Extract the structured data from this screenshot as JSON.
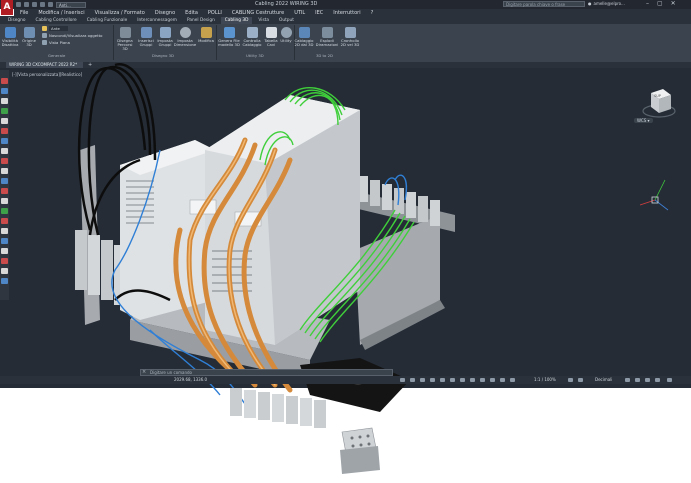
{
  "app": {
    "logo": "A",
    "title": "Cabling 2022  WIRING 3D",
    "workspace": "Anti...",
    "search_placeholder": "Digitare parola chiave o frase",
    "user": "amelle@elpro...",
    "win_controls": [
      "–",
      "▢",
      "✕"
    ]
  },
  "menu": [
    "File",
    "Modifica / Inserisci",
    "Visualizza / Formato",
    "Disegno",
    "Edita",
    "POLLI",
    "CABLING Cestrutture",
    "UTIL",
    "IEC",
    "Interruttori",
    "?"
  ],
  "ribbon_tabs": [
    {
      "label": "Disegno",
      "active": false
    },
    {
      "label": "Cabling Controllore",
      "active": false
    },
    {
      "label": "Cabling Funzionale",
      "active": false
    },
    {
      "label": "Interconnessagem",
      "active": false
    },
    {
      "label": "Panel Design",
      "active": false
    },
    {
      "label": "Cabling 3D",
      "active": true
    },
    {
      "label": "Vista",
      "active": false
    },
    {
      "label": "Output",
      "active": false
    }
  ],
  "ribbon": {
    "visibility_label": "Visibilità Disattiva",
    "origin_label": "Origine 3D",
    "combo_value": "Ante",
    "show_hide": "Nascondi/Visualizza oggetto",
    "plane_view": "Vista Piana",
    "general_panel": "Generale",
    "b1": "Disegna Percorsi 3D",
    "b2": "Inserisci Gruppi",
    "b3": "Imposta Gruppi",
    "b4": "Imposta Dimensione",
    "b5": "Modifica",
    "draw3d_panel": "Disegno 3D",
    "b6": "Genera File modello 3D",
    "b7": "Controlla Cablaggio",
    "b8": "Tabella Cavi",
    "b9": "Utility",
    "util3d_panel": "Utility 3D",
    "b10": "Cablaggio 2D dal 3D",
    "b11": "Esplodi Diramazioni",
    "b12": "Cronhollo 2D vel 3D",
    "panel_2d3d": "3D to 2D"
  },
  "file_tab": "WIRING 3D CXCOMPACT 2022 R2*",
  "viewport": {
    "label": "[-][Vista personalizzata][Realistico]",
    "cube_face": "SUP",
    "wcs": "WCS ▾"
  },
  "command": {
    "placeholder": "Digitare un comando"
  },
  "status": {
    "coords": "2029.68, 1336.0",
    "zoom": "1:1 / 100%",
    "units": "Decimali"
  },
  "colors": {
    "viewport_bg": "#252c36",
    "ribbon_bg": "#3b434e",
    "orange_cable": "#d48a3a",
    "green_wire": "#3fcf3a",
    "blue_wire": "#2f7fd6",
    "black_cable": "#111111"
  }
}
